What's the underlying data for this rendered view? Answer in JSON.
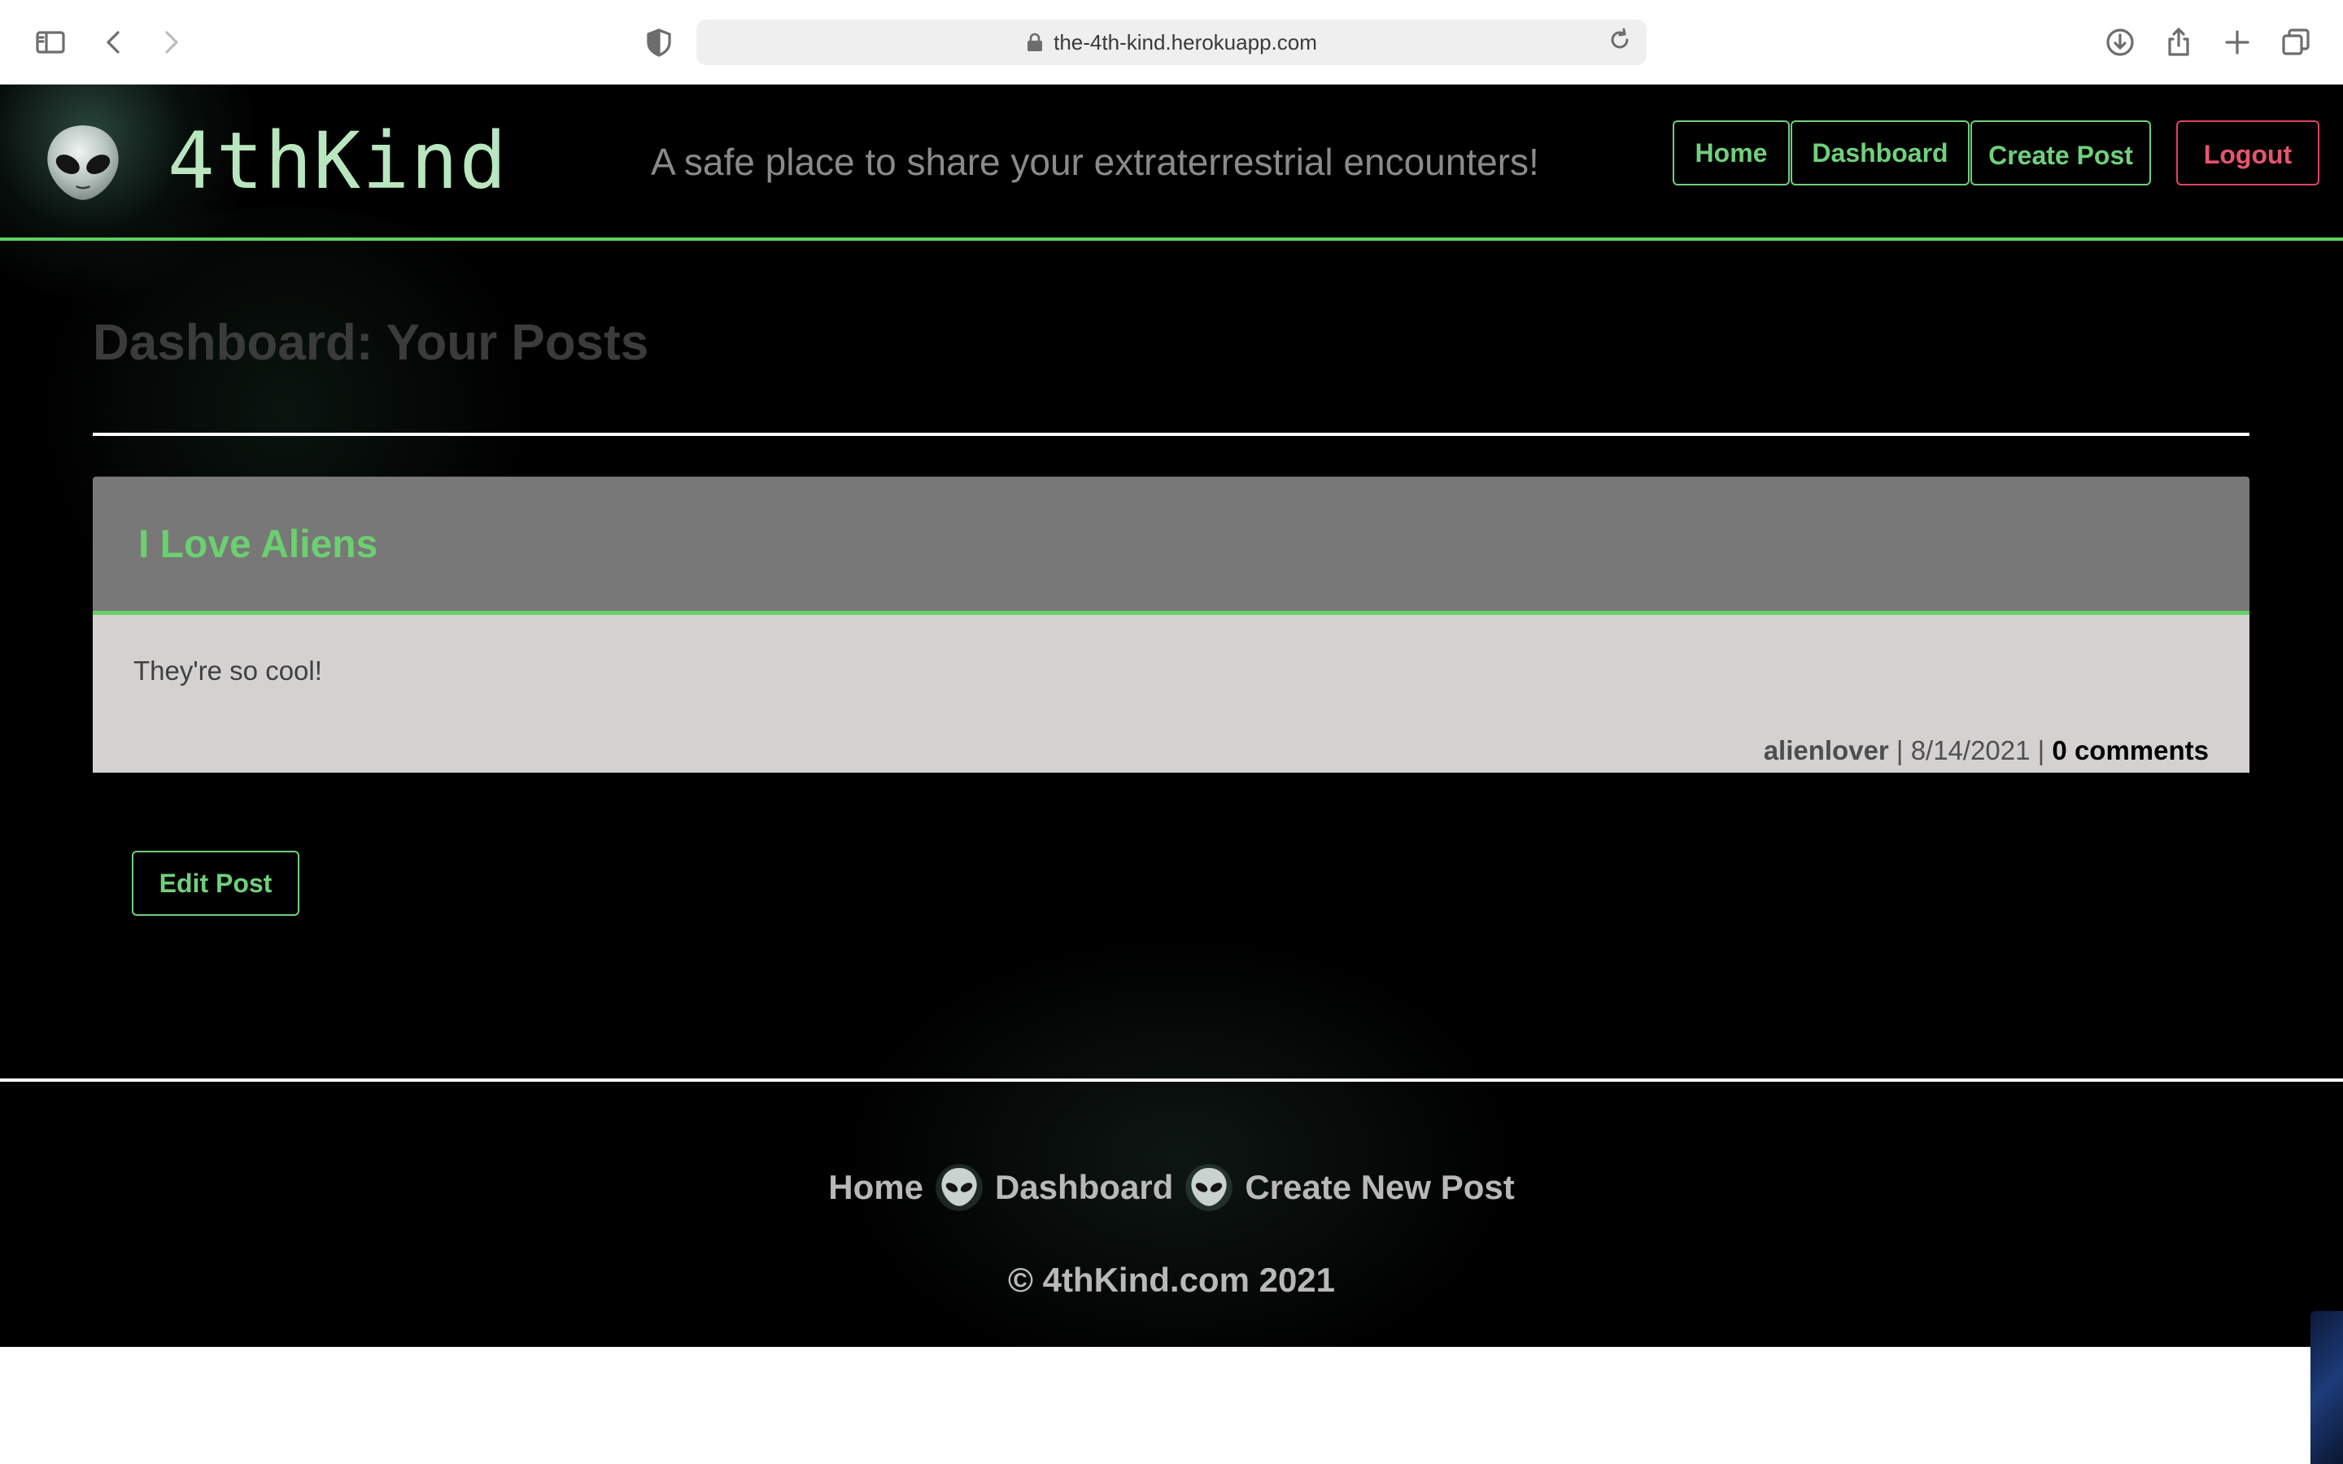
{
  "browser": {
    "url": "the-4th-kind.herokuapp.com",
    "icons": [
      "sidebar-icon",
      "back-icon",
      "forward-icon",
      "privacy-shield-icon",
      "lock-icon",
      "reload-icon",
      "download-icon",
      "share-icon",
      "new-tab-icon",
      "tab-overview-icon"
    ]
  },
  "site": {
    "logo_text": "4thKind",
    "tagline": "A safe place to share your extraterrestrial encounters!",
    "nav": {
      "home": "Home",
      "dashboard": "Dashboard",
      "create_post": "Create Post",
      "logout": "Logout"
    },
    "colors": {
      "accent_green": "#6fd17b",
      "logout_red": "#e8546e",
      "background": "#000000"
    }
  },
  "main": {
    "page_title": "Dashboard: Your Posts",
    "posts": [
      {
        "title": "I Love Aliens",
        "body": "They're so cool!",
        "author": "alienlover",
        "separator": " | ",
        "date": "8/14/2021",
        "comments": "0 comments"
      }
    ],
    "edit_button": "Edit Post"
  },
  "footer": {
    "links": {
      "home": "Home",
      "dashboard": "Dashboard",
      "create_new_post": "Create New Post"
    },
    "copyright": "© 4thKind.com 2021"
  }
}
